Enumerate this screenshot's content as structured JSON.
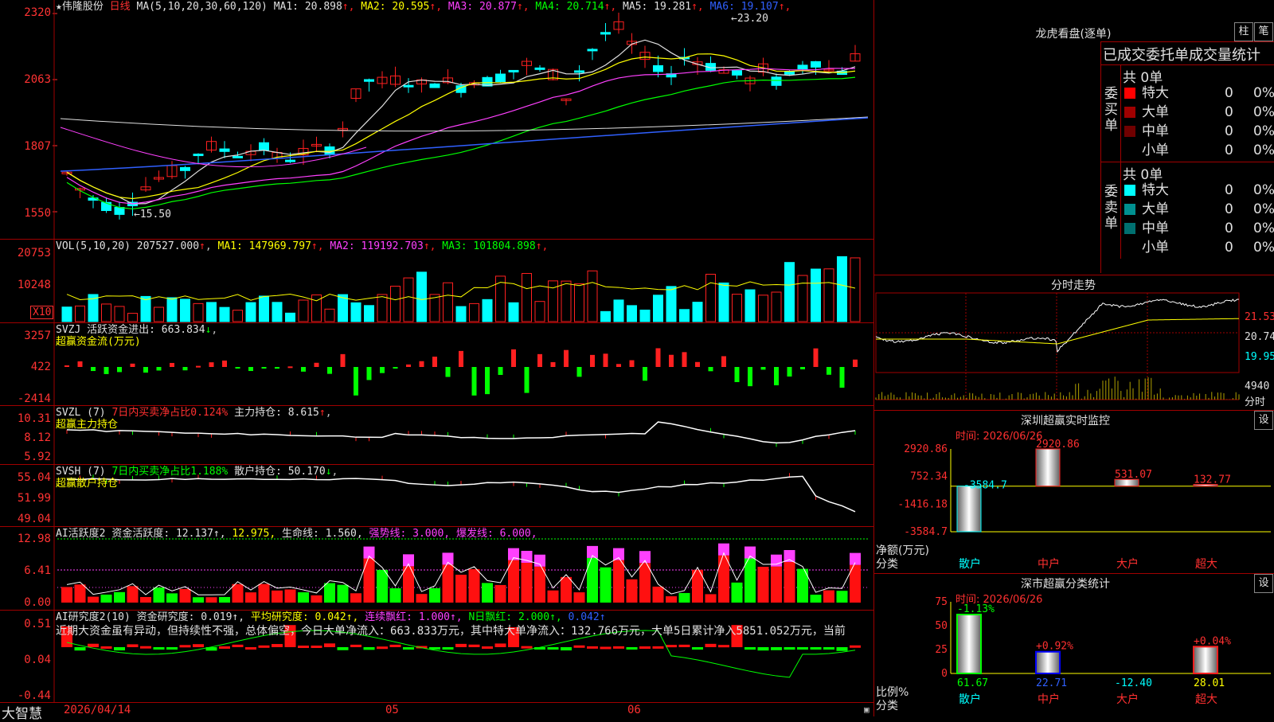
{
  "app": {
    "name": "大智慧",
    "date_label": "2026/04/",
    "day": "14",
    "month_labels": [
      "05",
      "06"
    ]
  },
  "main": {
    "stock": "★伟隆股份",
    "period": "日线",
    "ma_params": "MA(5,10,20,30,60,120)",
    "ma": [
      {
        "label": "MA1:",
        "value": "20.898",
        "color": "#e0e0e0"
      },
      {
        "label": "MA2:",
        "value": "20.595",
        "color": "#ffff00"
      },
      {
        "label": "MA3:",
        "value": "20.877",
        "color": "#ff40ff"
      },
      {
        "label": "MA4:",
        "value": "20.714",
        "color": "#00ff00"
      },
      {
        "label": "MA5:",
        "value": "19.281",
        "color": "#e0e0e0"
      },
      {
        "label": "MA6:",
        "value": "19.107",
        "color": "#3060ff"
      }
    ],
    "arrow": "↑",
    "y_ticks": [
      "2320",
      "2063",
      "1807",
      "1550"
    ],
    "high_label": "23.20",
    "low_label": "15.50"
  },
  "vol": {
    "title": "VOL(5,10,20)",
    "value": "207527.000",
    "ma": [
      {
        "label": "MA1:",
        "value": "147969.797",
        "color": "#ffff00"
      },
      {
        "label": "MA2:",
        "value": "119192.703",
        "color": "#ff40ff"
      },
      {
        "label": "MA3:",
        "value": "101804.898",
        "color": "#00ff00"
      }
    ],
    "y_ticks": [
      "20753",
      "10248"
    ],
    "unit": "X10"
  },
  "svzj": {
    "title": "SVZJ",
    "label": "活跃资金进出:",
    "value": "663.834",
    "arrow": "↓",
    "sub": "超赢资金流(万元)",
    "y_ticks": [
      "3257",
      "422",
      "-2414"
    ]
  },
  "svzl": {
    "title": "SVZL (7)",
    "pct": "7日内买卖净占比0.124%",
    "label": "主力持仓:",
    "value": "8.615",
    "arrow": "↑",
    "sub": "超赢主力持仓",
    "y_ticks": [
      "10.31",
      "8.12",
      "5.92"
    ]
  },
  "svsh": {
    "title": "SVSH (7)",
    "pct": "7日内买卖净占比1.188%",
    "label": "散户持仓:",
    "value": "50.170",
    "arrow": "↓",
    "sub": "超赢散户持仓",
    "y_ticks": [
      "55.04",
      "51.99",
      "49.04"
    ]
  },
  "ai1": {
    "title": "AI活跃度2",
    "items": [
      {
        "text": "资金活跃度: 12.137↑,",
        "color": "#e0e0e0"
      },
      {
        "text": "12.975,",
        "color": "#ffff00"
      },
      {
        "text": "生命线: 1.560,",
        "color": "#e0e0e0"
      },
      {
        "text": "强势线: 3.000,",
        "color": "#ff40ff"
      },
      {
        "text": "爆发线: 6.000,",
        "color": "#ff40ff"
      }
    ],
    "y_ticks": [
      "12.98",
      "6.41",
      "0.00"
    ]
  },
  "ai2": {
    "title": "AI研究度2(10)",
    "items": [
      {
        "text": "资金研究度: 0.019↑,",
        "color": "#e0e0e0"
      },
      {
        "text": "平均研究度: 0.042↑,",
        "color": "#ffff00"
      },
      {
        "text": "连续飘红: 1.000↑,",
        "color": "#ff40ff"
      },
      {
        "text": "N日飘红: 2.000↑,",
        "color": "#00ff00"
      },
      {
        "text": "0.042↑",
        "color": "#3060ff"
      }
    ],
    "comment": "近期大资金虽有异动，但持续性不强，总体偏空，今日大单净流入：663.833万元，其中特大单净流入：132.766万元，大单5日累计净入5851.052万元，当前",
    "y_ticks": [
      "0.51",
      "0.04",
      "-0.44"
    ]
  },
  "right": {
    "lhb_title": "龙虎看盘(逐单)",
    "btn_bar": "柱",
    "btn_pen": "笔",
    "stat_header": "已成交委托单成交量统计",
    "buy": {
      "side": "委买单",
      "total": "共 0单",
      "rows": [
        {
          "name": "特大",
          "count": "0",
          "pct": "0%",
          "color": "#ff0000"
        },
        {
          "name": "大单",
          "count": "0",
          "pct": "0%",
          "color": "#a00000"
        },
        {
          "name": "中单",
          "count": "0",
          "pct": "0%",
          "color": "#700000"
        },
        {
          "name": "小单",
          "count": "0",
          "pct": "0%",
          "color": "#000000"
        }
      ]
    },
    "sell": {
      "side": "委卖单",
      "total": "共 0单",
      "rows": [
        {
          "name": "特大",
          "count": "0",
          "pct": "0%",
          "color": "#00ffff"
        },
        {
          "name": "大单",
          "count": "0",
          "pct": "0%",
          "color": "#009090"
        },
        {
          "name": "中单",
          "count": "0",
          "pct": "0%",
          "color": "#007070"
        },
        {
          "name": "小单",
          "count": "0",
          "pct": "0%",
          "color": "#000000"
        }
      ]
    },
    "intraday": {
      "title": "分时走势",
      "prices": [
        "21.53",
        "20.74",
        "19.95"
      ],
      "vol": "4940",
      "vol_unit": "分时"
    },
    "sz_monitor": {
      "title": "深圳超赢实时监控",
      "set": "设",
      "time": "时间: 2026/06/26",
      "y_ticks": [
        "2920.86",
        "752.34",
        "-1416.18",
        "-3584.7"
      ],
      "ylabel": "净额(万元)",
      "xlabel": "分类",
      "categories": [
        "散户",
        "中户",
        "大户",
        "超大"
      ],
      "values": [
        -3584.7,
        2920.86,
        531.07,
        132.77
      ],
      "value_labels": [
        "-3584.7",
        "2920.86",
        "531.07",
        "132.77"
      ]
    },
    "sz_stats": {
      "title": "深市超赢分类统计",
      "set": "设",
      "time": "时间: 2026/06/26",
      "y_ticks": [
        "75",
        "50",
        "25",
        "0"
      ],
      "ylabel": "比例%",
      "xlabel": "分类",
      "categories": [
        "散户",
        "中户",
        "大户",
        "超大"
      ],
      "values": [
        61.67,
        22.71,
        -12.4,
        28.01
      ],
      "changes": [
        "-1.13%",
        "+0.92%",
        "",
        "+0.04%"
      ]
    }
  }
}
